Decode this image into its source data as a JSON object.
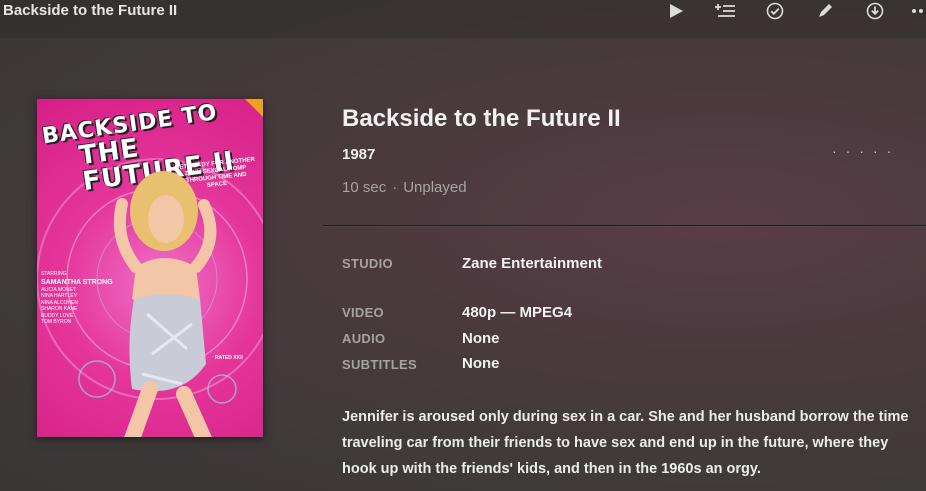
{
  "window": {
    "title": "Backside to the Future II"
  },
  "toolbar": {
    "actions": [
      {
        "name": "play",
        "icon": "play-icon"
      },
      {
        "name": "add-to-queue",
        "icon": "add-to-list-icon"
      },
      {
        "name": "mark-played",
        "icon": "check-circle-icon"
      },
      {
        "name": "edit",
        "icon": "pencil-icon"
      },
      {
        "name": "download",
        "icon": "download-circle-icon"
      },
      {
        "name": "more",
        "icon": "more-dots-icon"
      }
    ]
  },
  "poster": {
    "title_line1": "BACKSIDE TO",
    "title_line2": "THE FUTURE II",
    "tagline": "GET READY FOR ANOTHER ZANY SEXUAL ROMP THROUGH TIME AND SPACE",
    "cast_heading": "STARRING",
    "star": "SAMANTHA STRONG",
    "cast": [
      "ALICIA MONET",
      "NINA HARTLEY",
      "NINA ALCOHEN",
      "SHARON KANE",
      "BUDDY LOVE",
      "TOM BYRON"
    ],
    "rating": "RATED XXX",
    "colors": {
      "background": "#e4359a",
      "corner": "#f0a020"
    }
  },
  "movie": {
    "title": "Backside to the Future II",
    "year": "1987",
    "duration": "10 sec",
    "separator": "·",
    "status": "Unplayed"
  },
  "details": {
    "studio_label": "STUDIO",
    "studio_value": "Zane Entertainment",
    "video_label": "VIDEO",
    "video_value": "480p — MPEG4",
    "audio_label": "AUDIO",
    "audio_value": "None",
    "subtitles_label": "SUBTITLES",
    "subtitles_value": "None"
  },
  "summary": "Jennifer is aroused only during sex in a car. She and her husband borrow the time traveling car from their friends to have sex and end up in the future, where they hook up with the friends' kids, and then in the 1960s an orgy.",
  "more_dots": "·····"
}
